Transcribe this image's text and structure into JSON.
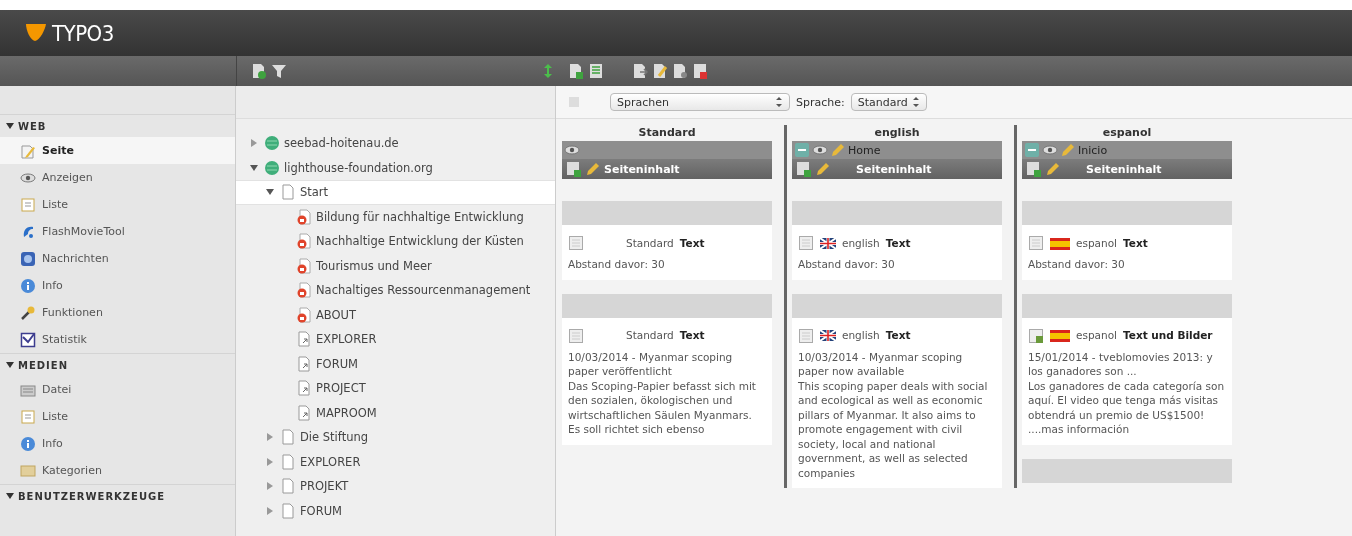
{
  "app": {
    "logo": "TYPO3"
  },
  "module_menu": [
    {
      "title": "WEB",
      "expanded": true,
      "items": [
        {
          "label": "Seite",
          "selected": true
        },
        {
          "label": "Anzeigen",
          "selected": false
        },
        {
          "label": "Liste",
          "selected": false
        },
        {
          "label": "FlashMovieTool",
          "selected": false
        },
        {
          "label": "Nachrichten",
          "selected": false
        },
        {
          "label": "Info",
          "selected": false
        },
        {
          "label": "Funktionen",
          "selected": false
        },
        {
          "label": "Statistik",
          "selected": false
        }
      ]
    },
    {
      "title": "MEDIEN",
      "expanded": true,
      "items": [
        {
          "label": "Datei",
          "selected": false
        },
        {
          "label": "Liste",
          "selected": false
        },
        {
          "label": "Info",
          "selected": false
        },
        {
          "label": "Kategorien",
          "selected": false
        }
      ]
    },
    {
      "title": "BENUTZERWERKZEUGE",
      "expanded": true
    }
  ],
  "tree": [
    {
      "label": "seebad-hoitenau.de",
      "kind": "site",
      "expanded": false,
      "selected": false
    },
    {
      "label": "lighthouse-foundation.org",
      "kind": "site",
      "expanded": true,
      "selected": false,
      "children": [
        {
          "label": "Start",
          "kind": "page",
          "expanded": true,
          "selected": true,
          "children": [
            {
              "label": "Bildung für nachhaltige Entwicklung",
              "kind": "restricted",
              "selected": false
            },
            {
              "label": "Nachhaltige Entwicklung der Küsten",
              "kind": "restricted",
              "selected": false
            },
            {
              "label": "Tourismus und Meer",
              "kind": "restricted",
              "selected": false
            },
            {
              "label": "Nachaltiges Ressourcenmanagement",
              "kind": "restricted",
              "selected": false
            },
            {
              "label": "ABOUT",
              "kind": "restricted",
              "selected": false
            },
            {
              "label": "EXPLORER",
              "kind": "shortcut",
              "selected": false
            },
            {
              "label": "FORUM",
              "kind": "shortcut",
              "selected": false
            },
            {
              "label": "PROJECT",
              "kind": "shortcut",
              "selected": false
            },
            {
              "label": "MAPROOM",
              "kind": "shortcut",
              "selected": false
            }
          ]
        },
        {
          "label": "Die Stiftung",
          "kind": "page",
          "expanded": false,
          "selected": false
        },
        {
          "label": "EXPLORER",
          "kind": "page",
          "expanded": false,
          "selected": false
        },
        {
          "label": "PROJEKT",
          "kind": "page",
          "expanded": false,
          "selected": false
        },
        {
          "label": "FORUM",
          "kind": "page",
          "expanded": false,
          "selected": false
        }
      ]
    }
  ],
  "doc_header": {
    "view_select": "Sprachen",
    "language_label": "Sprache:",
    "language_select": "Standard"
  },
  "columns": [
    {
      "heading": "Standard",
      "section": "Seiteninhalt",
      "elements": [
        {
          "kind": "text",
          "language": "Standard",
          "type": "Text",
          "body": "Abstand davor: 30"
        },
        {
          "kind": "text",
          "language": "Standard",
          "type": "Text",
          "headline": "10/03/2014 - Myanmar scoping paper veröffentlicht",
          "body": "Das Scoping-Papier befasst sich mit den sozialen, ökologischen und wirtschaftlichen Säulen Myanmars. Es soll richtet sich ebenso"
        }
      ]
    },
    {
      "heading": "english",
      "page_title": "Home",
      "section": "Seiteninhalt",
      "elements": [
        {
          "kind": "text",
          "language": "english",
          "type": "Text",
          "body": "Abstand davor: 30"
        },
        {
          "kind": "text",
          "language": "english",
          "type": "Text",
          "headline": "10/03/2014 - Myanmar scoping paper now available",
          "body": "This scoping paper deals with social and ecological as well as economic pillars of Myanmar. It also aims to promote engagement with civil society, local and national government, as well as selected companies"
        }
      ]
    },
    {
      "heading": "espanol",
      "page_title": "Inicio",
      "section": "Seiteninhalt",
      "elements": [
        {
          "kind": "text",
          "language": "espanol",
          "type": "Text",
          "body": "Abstand davor: 30"
        },
        {
          "kind": "textpic",
          "language": "espanol",
          "type": "Text und Bilder",
          "headline": "15/01/2014 - tveblomovies 2013: y los ganadores son ...",
          "body": "Los ganadores de cada categoría son aquí. El video que tenga más visitas obtendrá un premio de US$1500! ....mas información"
        },
        {
          "kind": "strip"
        }
      ]
    }
  ]
}
